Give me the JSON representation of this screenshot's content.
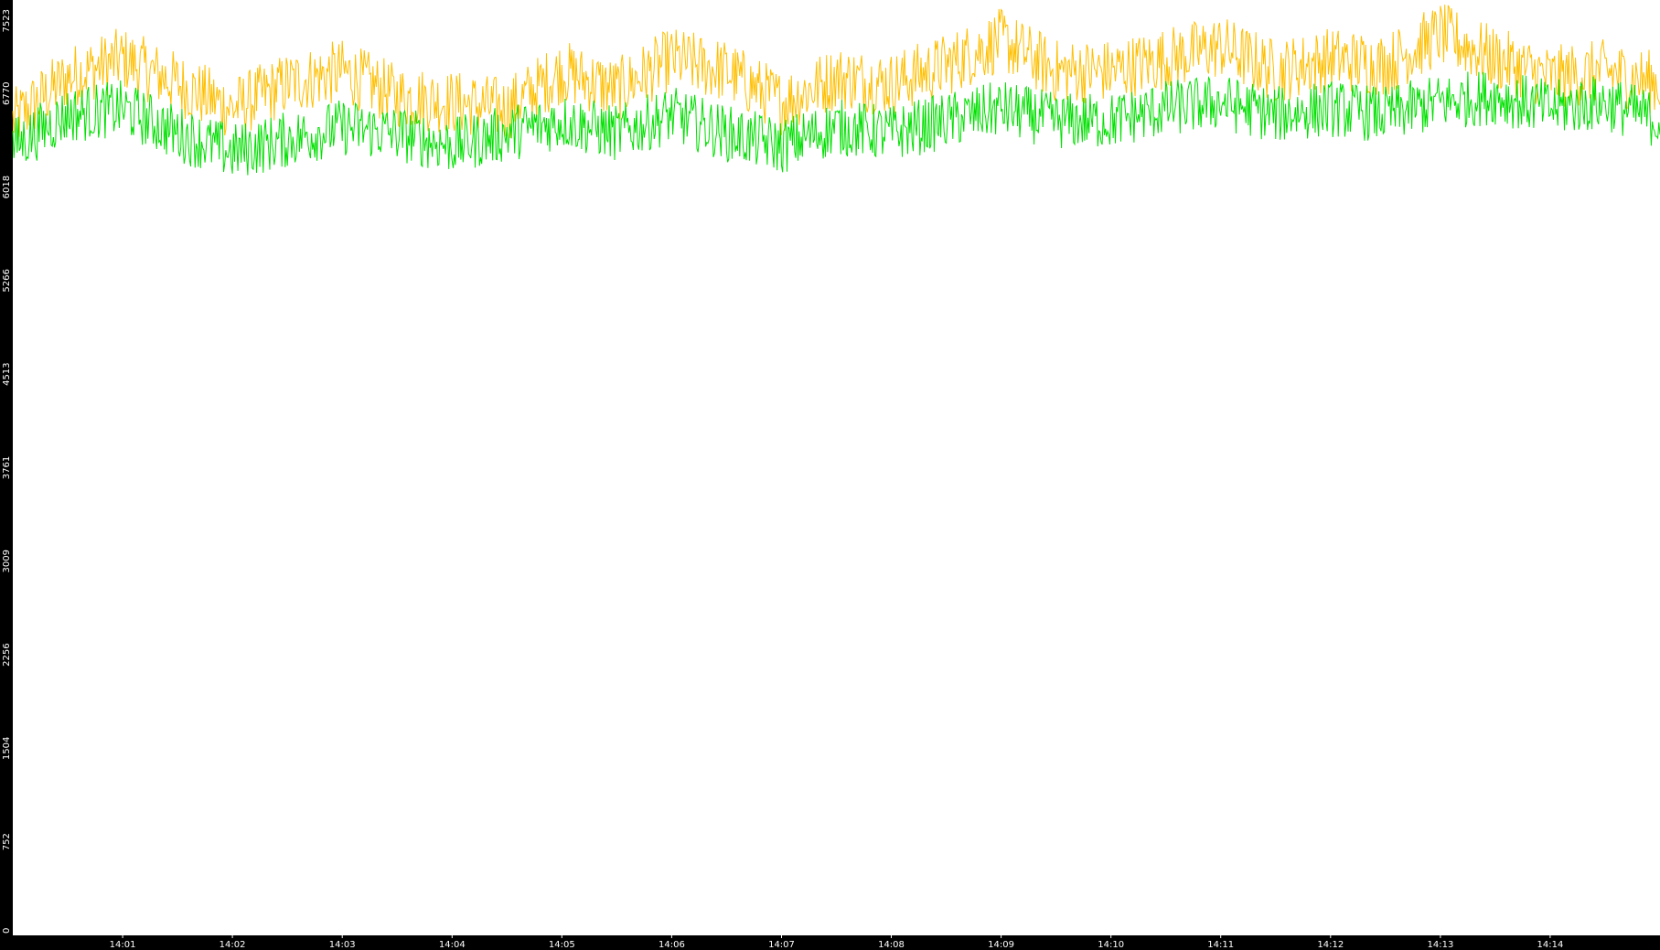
{
  "chart_data": {
    "type": "line",
    "title": "",
    "xlabel": "",
    "ylabel": "",
    "ylim": [
      0,
      7523
    ],
    "y_tick_labels": [
      "0",
      "752",
      "1504",
      "2256",
      "3009",
      "3761",
      "4513",
      "5266",
      "6018",
      "6770",
      "7523"
    ],
    "x_tick_labels": [
      "14:01",
      "14:02",
      "14:03",
      "14:04",
      "14:05",
      "14:06",
      "14:07",
      "14:08",
      "14:09",
      "14:10",
      "14:11",
      "14:12",
      "14:13",
      "14:14"
    ],
    "x_range_minutes": [
      0,
      15
    ],
    "grid": false,
    "legend": "none",
    "colors": {
      "background": "#ffffff",
      "frame": "#000000",
      "series_orange": "#ffbf00",
      "series_green": "#00e000",
      "tick_text": "#ffffff"
    },
    "series": [
      {
        "color": "#ffbf00",
        "x_min": [
          0,
          0.5,
          1,
          1.5,
          2,
          2.5,
          3,
          3.5,
          4,
          4.5,
          5,
          5.5,
          6,
          6.5,
          7,
          7.5,
          8,
          8.5,
          9,
          9.5,
          10,
          10.5,
          11,
          11.5,
          12,
          12.5,
          13,
          13.5,
          14,
          14.5,
          15
        ],
        "values": [
          6550,
          6900,
          7050,
          6850,
          6650,
          6850,
          6950,
          6750,
          6700,
          6650,
          6950,
          6800,
          7050,
          6950,
          6700,
          6900,
          6850,
          7000,
          7200,
          6950,
          6950,
          7050,
          7150,
          6950,
          7050,
          7000,
          7250,
          7050,
          6900,
          6950,
          6850
        ]
      },
      {
        "color": "#00e000",
        "x_min": [
          0,
          0.5,
          1,
          1.5,
          2,
          2.5,
          3,
          3.5,
          4,
          4.5,
          5,
          5.5,
          6,
          6.5,
          7,
          7.5,
          8,
          8.5,
          9,
          9.5,
          10,
          10.5,
          11,
          11.5,
          12,
          12.5,
          13,
          13.5,
          14,
          14.5,
          15
        ],
        "values": [
          6350,
          6600,
          6650,
          6450,
          6300,
          6400,
          6500,
          6450,
          6350,
          6450,
          6550,
          6450,
          6600,
          6450,
          6350,
          6500,
          6450,
          6550,
          6650,
          6550,
          6550,
          6650,
          6700,
          6600,
          6650,
          6600,
          6700,
          6750,
          6650,
          6700,
          6550
        ]
      }
    ]
  }
}
